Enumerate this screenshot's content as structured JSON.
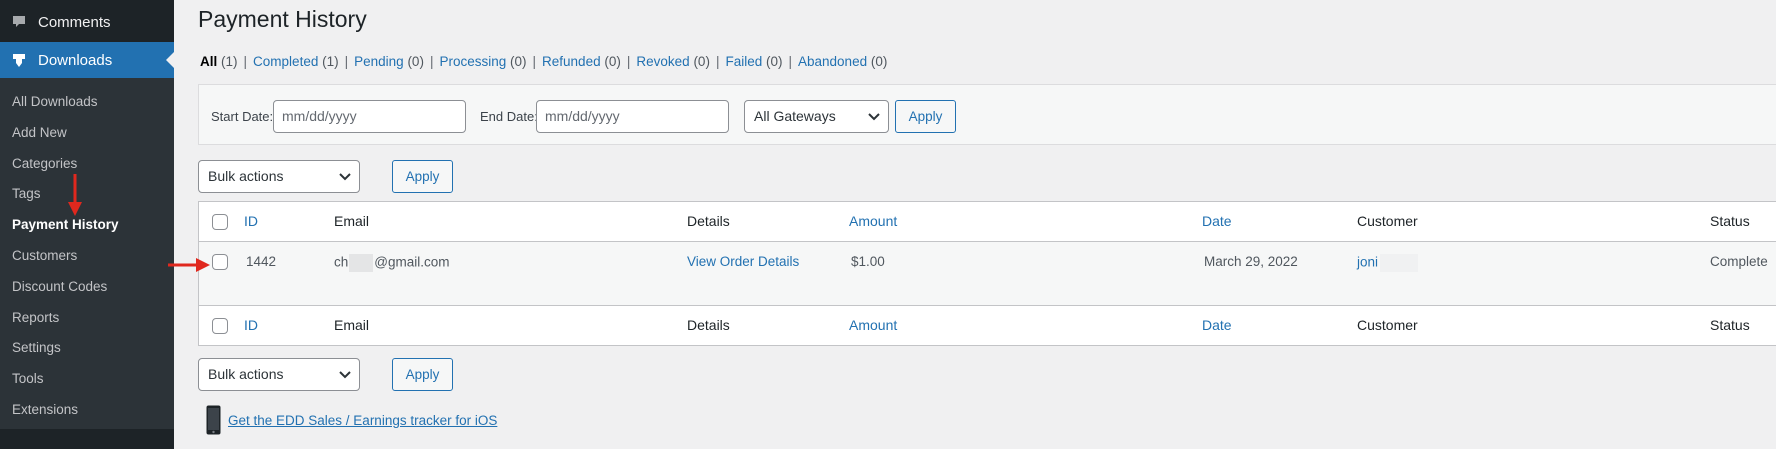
{
  "sidebar": {
    "comments_label": "Comments",
    "downloads_label": "Downloads",
    "submenu": [
      "All Downloads",
      "Add New",
      "Categories",
      "Tags",
      "Payment History",
      "Customers",
      "Discount Codes",
      "Reports",
      "Settings",
      "Tools",
      "Extensions"
    ],
    "current_item": "Payment History"
  },
  "page": {
    "title": "Payment History"
  },
  "status_filters": [
    {
      "label": "All",
      "count": "(1)",
      "current": true
    },
    {
      "label": "Completed",
      "count": "(1)"
    },
    {
      "label": "Pending",
      "count": "(0)"
    },
    {
      "label": "Processing",
      "count": "(0)"
    },
    {
      "label": "Refunded",
      "count": "(0)"
    },
    {
      "label": "Revoked",
      "count": "(0)"
    },
    {
      "label": "Failed",
      "count": "(0)"
    },
    {
      "label": "Abandoned",
      "count": "(0)"
    }
  ],
  "filters": {
    "start_label": "Start Date:",
    "start_placeholder": "mm/dd/yyyy",
    "end_label": "End Date:",
    "end_placeholder": "mm/dd/yyyy",
    "gateway_selected": "All Gateways",
    "apply_label": "Apply"
  },
  "bulk": {
    "selected": "Bulk actions",
    "apply_label": "Apply"
  },
  "table": {
    "columns": [
      "ID",
      "Email",
      "Details",
      "Amount",
      "Date",
      "Customer",
      "Status"
    ],
    "rows": [
      {
        "id": "1442",
        "email_prefix": "ch",
        "email_suffix": "@gmail.com",
        "details": "View Order Details",
        "amount": "$1.00",
        "date": "March 29, 2022",
        "customer": "joni",
        "status": "Complete"
      }
    ]
  },
  "footer": {
    "ios_link": "Get the EDD Sales / Earnings tracker for iOS"
  },
  "colors": {
    "sidebar_bg": "#1d2327",
    "submenu_bg": "#2c3338",
    "accent": "#2271b1",
    "annotation_arrow": "#e0281e"
  },
  "icons": [
    "comment-icon",
    "download-icon",
    "chevron-down-icon",
    "phone-icon",
    "arrow-annotation"
  ]
}
